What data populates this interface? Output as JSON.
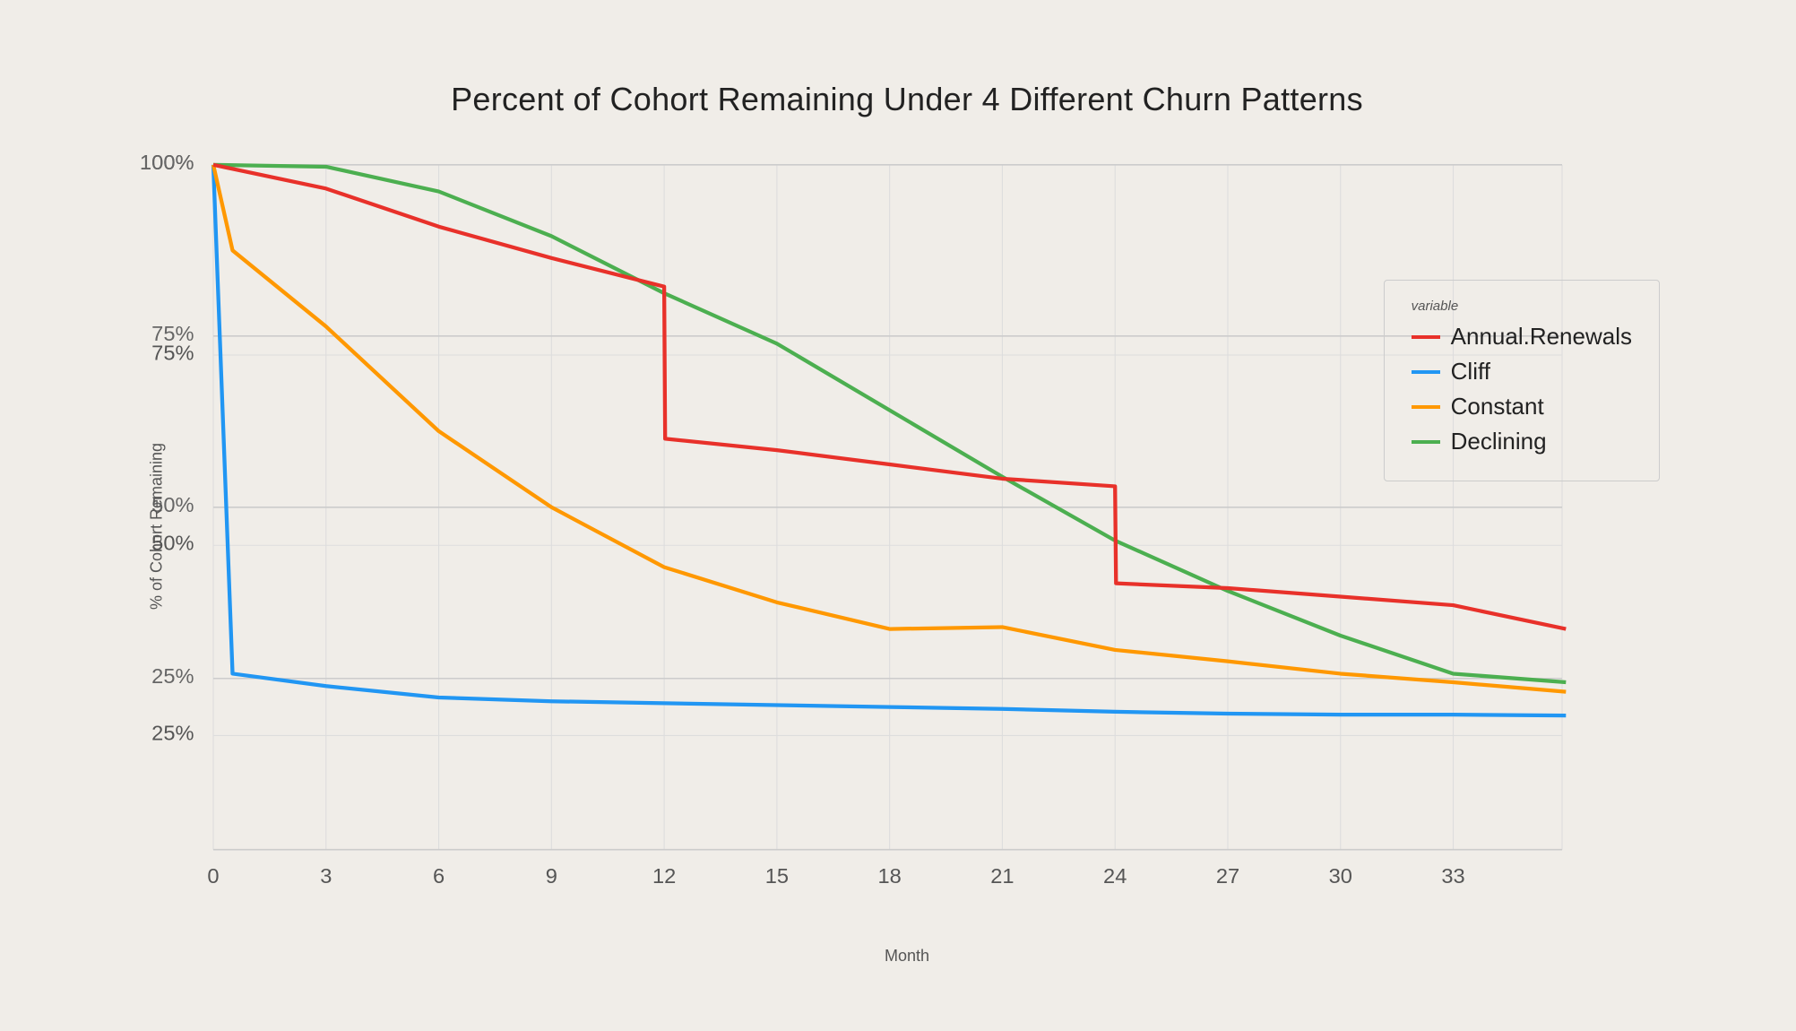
{
  "chart": {
    "title": "Percent of Cohort Remaining Under 4 Different Churn Patterns",
    "y_axis_label": "% of Cohort Remaining",
    "x_axis_label": "Month",
    "y_ticks": [
      "25%",
      "50%",
      "75%",
      "100%"
    ],
    "x_ticks": [
      "0",
      "3",
      "6",
      "9",
      "12",
      "15",
      "18",
      "21",
      "24",
      "27",
      "30",
      "33"
    ],
    "legend": {
      "title": "variable",
      "items": [
        {
          "label": "Annual.Renewals",
          "color": "#e8312a"
        },
        {
          "label": "Cliff",
          "color": "#2196f3"
        },
        {
          "label": "Constant",
          "color": "#ff9800"
        },
        {
          "label": "Declining",
          "color": "#4caf50"
        }
      ]
    }
  }
}
